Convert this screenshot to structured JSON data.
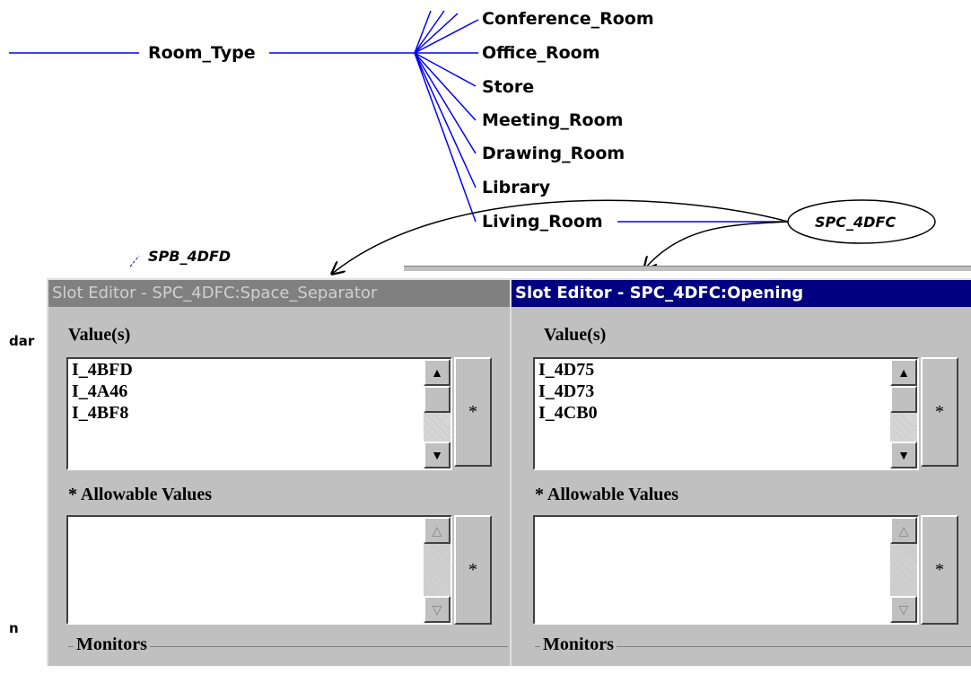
{
  "graph": {
    "root_node": "Room_Type",
    "children": [
      "Conference_Room",
      "Office_Room",
      "Store",
      "Meeting_Room",
      "Drawing_Room",
      "Library",
      "Living_Room"
    ],
    "instance_node": "SPC_4DFC",
    "other_node": "SPB_4DFD",
    "left_fragment_1": "dar",
    "left_fragment_2": "n",
    "edge_color": "#0000ff"
  },
  "windows": [
    {
      "title": "Slot Editor - SPC_4DFC:Space_Separator",
      "active": false,
      "values_label": "Value(s)",
      "values": [
        "I_4BFD",
        "I_4A46",
        "I_4BF8"
      ],
      "values_button": "*",
      "allowable_label": "* Allowable Values",
      "allowable_values": [],
      "allowable_button": "*",
      "monitors_label": "Monitors"
    },
    {
      "title": "Slot Editor - SPC_4DFC:Opening",
      "active": true,
      "values_label": "Value(s)",
      "values": [
        "I_4D75",
        "I_4D73",
        "I_4CB0"
      ],
      "values_button": "*",
      "allowable_label": "* Allowable Values",
      "allowable_values": [],
      "allowable_button": "*",
      "monitors_label": "Monitors"
    }
  ],
  "colors": {
    "active_title": "#000080",
    "inactive_title": "#808080",
    "window_face": "#c0c0c0"
  }
}
